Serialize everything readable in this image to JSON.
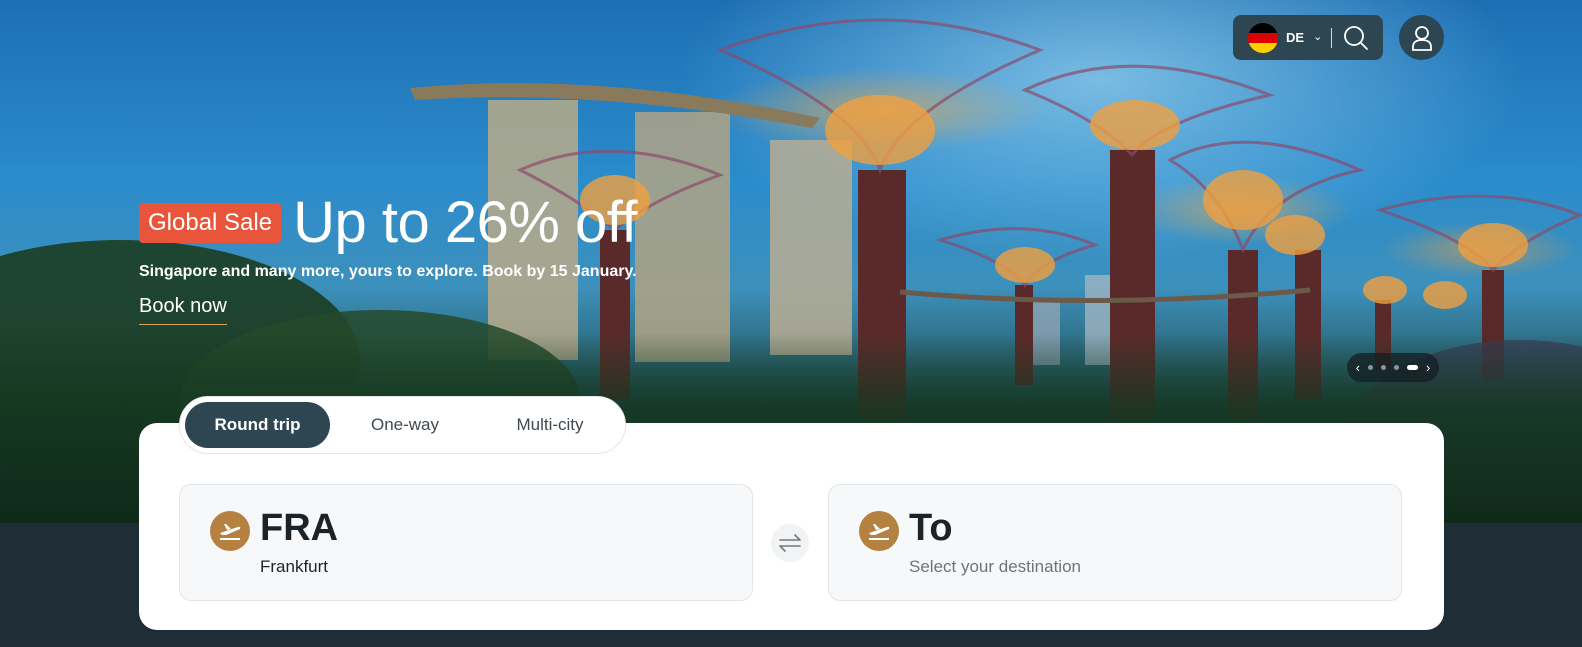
{
  "header": {
    "locale_code": "DE",
    "flag_colors": [
      "#000000",
      "#dd0000",
      "#ffce00"
    ]
  },
  "hero": {
    "badge": "Global Sale",
    "headline": "Up to 26% off",
    "subline": "Singapore and many more, yours to explore. Book by 15 January.",
    "cta": "Book now",
    "slides_total": 4,
    "active_slide": 4
  },
  "search": {
    "tabs": [
      "Round trip",
      "One-way",
      "Multi-city"
    ],
    "active_tab": "Round trip",
    "from": {
      "code": "FRA",
      "city": "Frankfurt"
    },
    "to": {
      "code": "To",
      "placeholder": "Select your destination"
    }
  },
  "colors": {
    "accent": "#b58140",
    "badge": "#e8553b",
    "dark": "#2e4652"
  }
}
